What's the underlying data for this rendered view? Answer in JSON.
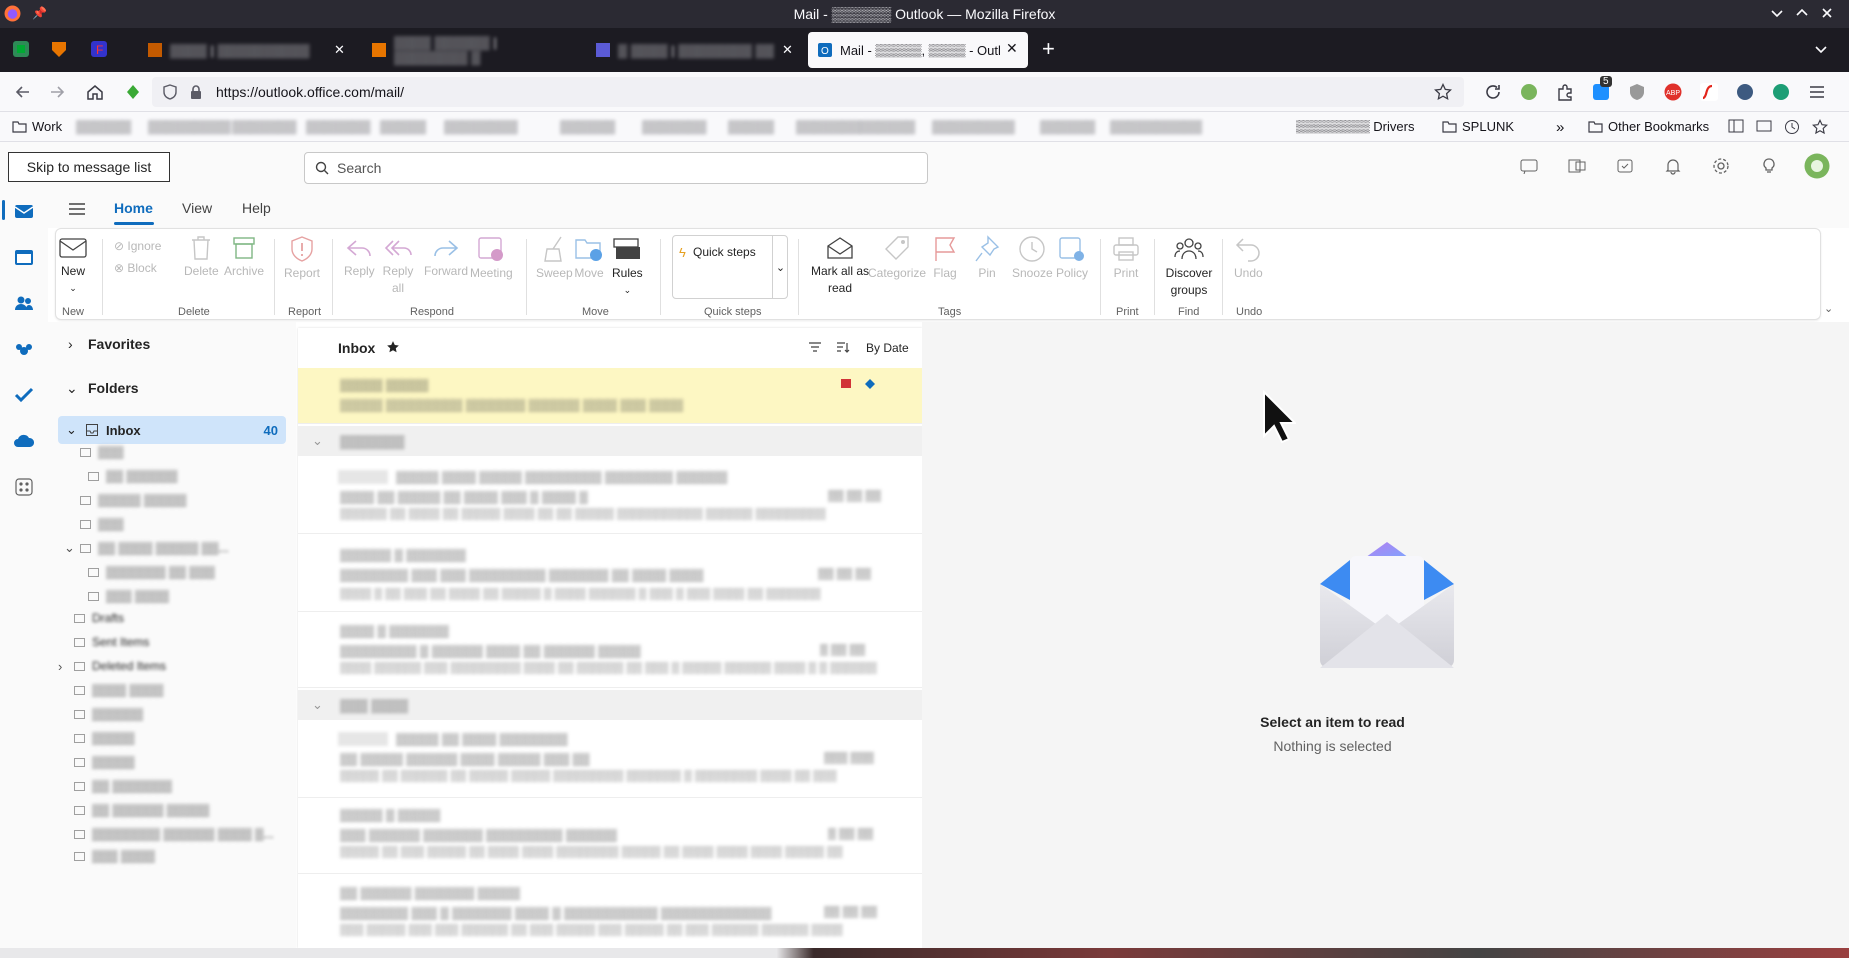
{
  "browser": {
    "window_title": "Mail - ▒▒▒▒▒▒ Outlook — Mozilla Firefox",
    "tabs": [
      {
        "label": "▒▒▒▒ | ▒▒▒▒▒▒▒▒▒▒"
      },
      {
        "label": "▒▒▒▒ ▒▒▒▒▒▒ | ▒▒▒▒▒▒▒▒ ▒"
      },
      {
        "label": "▒ ▒▒▒▒ | ▒▒▒▒▒▒▒▒ ▒▒"
      },
      {
        "label": "Mail - ▒▒▒▒▒, ▒▒▒▒ - Outlo"
      }
    ],
    "url": "https://outlook.office.com/mail/",
    "extension_badge": "5",
    "bookmarks": [
      "Work",
      "▒▒▒▒▒▒",
      "▒▒▒▒▒▒▒▒▒",
      "▒▒▒▒▒▒▒",
      "▒▒▒▒▒▒▒",
      "▒▒▒▒▒",
      "▒▒▒▒▒▒▒▒",
      "▒▒▒▒▒▒",
      "▒▒▒▒▒▒▒",
      "▒▒▒▒▒",
      "▒▒▒▒▒▒▒",
      "▒▒▒▒▒▒",
      "▒▒▒▒▒▒▒▒▒",
      "▒▒▒▒▒▒",
      "▒▒▒▒▒▒▒▒▒▒",
      "▒▒▒▒▒▒▒▒ Drivers",
      "SPLUNK"
    ],
    "other_bookmarks": "Other Bookmarks"
  },
  "outlook": {
    "skip_label": "Skip to message list",
    "search_placeholder": "Search",
    "ribbon_tabs": [
      "Home",
      "View",
      "Help"
    ],
    "ribbon": {
      "new": "New",
      "ignore": "Ignore",
      "block": "Block",
      "delete": "Delete",
      "archive": "Archive",
      "report": "Report",
      "reply": "Reply",
      "reply_all": "Reply all",
      "forward": "Forward",
      "meeting": "Meeting",
      "sweep": "Sweep",
      "move": "Move",
      "rules": "Rules",
      "quick_steps": "Quick steps",
      "mark_all_read": "Mark all as read",
      "categorize": "Categorize",
      "flag": "Flag",
      "pin": "Pin",
      "snooze": "Snooze",
      "policy": "Policy",
      "print": "Print",
      "discover_groups": "Discover groups",
      "undo": "Undo",
      "groups": {
        "new": "New",
        "delete": "Delete",
        "report": "Report",
        "respond": "Respond",
        "move": "Move",
        "quick_steps": "Quick steps",
        "tags": "Tags",
        "print": "Print",
        "find": "Find",
        "undo": "Undo"
      }
    },
    "favorites": "Favorites",
    "folders_label": "Folders",
    "inbox": {
      "label": "Inbox",
      "count": "40"
    },
    "folders": [
      {
        "label": "▒▒▒"
      },
      {
        "label": "▒▒ ▒▒▒▒▒▒"
      },
      {
        "label": "▒▒▒▒▒ ▒▒▒▒▒"
      },
      {
        "label": "▒▒▒"
      },
      {
        "label": "▒▒ ▒▒▒▒ ▒▒▒▒▒ ▒▒..."
      },
      {
        "label": "▒▒▒▒▒▒▒ ▒▒ ▒▒▒"
      },
      {
        "label": "▒▒▒ ▒▒▒▒"
      },
      {
        "label": "Drafts"
      },
      {
        "label": "Sent Items"
      },
      {
        "label": "Deleted Items"
      },
      {
        "label": "▒▒▒▒ ▒▒▒▒"
      },
      {
        "label": "▒▒▒▒▒▒"
      },
      {
        "label": "▒▒▒▒▒"
      },
      {
        "label": "▒▒▒▒▒"
      },
      {
        "label": "▒▒ ▒▒▒▒▒▒▒"
      },
      {
        "label": "▒▒ ▒▒▒▒▒▒ ▒▒▒▒▒"
      },
      {
        "label": "▒▒▒▒▒▒▒▒ ▒▒▒▒▒▒ ▒▒▒▒ ▒..."
      },
      {
        "label": "▒▒▒ ▒▒▒▒"
      }
    ],
    "list_title": "Inbox",
    "sort_label": "By Date",
    "groups": [
      "▒▒▒▒▒▒▒",
      "▒▒▒ ▒▒▒▒"
    ],
    "messages": [
      {
        "sender": "▒▒▒▒▒ ▒▒▒▒▒",
        "subject": "▒▒▒▒▒ ▒▒▒▒▒▒▒▒▒ ▒▒▒▒▒▒▒ ▒▒▒▒▒▒ ▒▒▒▒ ▒▒▒ ▒▒▒▒",
        "preview": "",
        "time": ""
      },
      {
        "sender": "▒▒▒▒▒ ▒▒▒▒ ▒▒▒▒▒ ▒▒▒▒▒▒▒▒▒ ▒▒▒▒▒▒▒▒ ▒▒▒▒▒▒",
        "subject": "▒▒▒▒ ▒▒ ▒▒▒▒▒ ▒▒ ▒▒▒▒ ▒▒▒ ▒ ▒▒▒▒ ▒",
        "preview": "▒▒▒▒▒▒ ▒▒ ▒▒▒▒ ▒▒ ▒▒▒▒▒ ▒▒▒▒ ▒▒ ▒▒ ▒▒▒▒▒ ▒▒▒▒▒▒▒▒▒▒▒ ▒▒▒▒▒▒ ▒▒▒▒▒▒▒▒▒",
        "time": "▒▒ ▒▒ ▒▒"
      },
      {
        "sender": "▒▒▒▒▒▒ ▒ ▒▒▒▒▒▒▒",
        "subject": "▒▒▒▒▒▒▒▒ ▒▒▒ ▒▒▒ ▒▒▒▒▒▒▒▒▒ ▒▒▒▒▒▒▒ ▒▒ ▒▒▒▒ ▒▒▒▒",
        "preview": "▒▒▒▒ ▒ ▒▒ ▒▒▒ ▒▒ ▒▒▒▒ ▒▒ ▒▒▒▒▒ ▒ ▒▒▒▒ ▒▒▒▒▒▒ ▒ ▒▒▒ ▒ ▒▒▒ ▒▒▒▒ ▒▒ ▒▒▒▒▒▒▒",
        "time": "▒▒ ▒▒ ▒▒"
      },
      {
        "sender": "▒▒▒▒ ▒ ▒▒▒▒▒▒▒",
        "subject": "▒▒▒▒▒▒▒▒▒ ▒ ▒▒▒▒▒▒ ▒▒▒▒ ▒▒ ▒▒▒▒▒▒ ▒▒▒▒▒",
        "preview": "▒▒▒▒ ▒▒▒▒▒▒ ▒▒▒ ▒▒▒▒▒▒▒▒▒ ▒▒▒▒ ▒▒ ▒▒▒▒▒▒ ▒▒ ▒▒▒ ▒ ▒▒▒▒▒ ▒▒▒▒▒▒ ▒▒▒▒ ▒ ▒ ▒▒▒▒▒▒",
        "time": "▒ ▒▒ ▒▒"
      },
      {
        "sender": "▒▒▒▒▒ ▒▒ ▒▒▒▒ ▒▒▒▒▒▒▒▒",
        "subject": "▒▒ ▒▒▒▒▒ ▒▒▒▒▒▒ ▒▒▒▒ ▒▒▒▒▒ ▒▒▒ ▒▒",
        "preview": "▒▒▒▒▒ ▒▒ ▒▒▒▒▒▒ ▒▒ ▒▒▒▒▒ ▒▒▒▒▒ ▒▒▒▒▒▒▒▒▒ ▒▒▒▒▒▒▒ ▒ ▒▒▒▒▒▒▒▒ ▒▒▒▒ ▒▒ ▒▒▒",
        "time": "▒▒▒ ▒▒▒"
      },
      {
        "sender": "▒▒▒▒▒ ▒ ▒▒▒▒▒",
        "subject": "▒▒▒ ▒▒▒▒▒▒ ▒▒▒▒▒▒▒ ▒▒▒▒▒▒▒▒▒ ▒▒▒▒▒▒",
        "preview": "▒▒▒▒▒ ▒▒ ▒▒▒ ▒▒▒▒▒ ▒▒ ▒▒▒▒ ▒▒▒▒ ▒▒▒▒▒▒▒▒ ▒▒▒▒▒ ▒▒ ▒▒▒▒ ▒▒▒▒ ▒▒▒▒ ▒▒▒▒▒ ▒▒",
        "time": "▒ ▒▒ ▒▒"
      },
      {
        "sender": "▒▒ ▒▒▒▒▒▒ ▒▒▒▒▒▒▒ ▒▒▒▒▒",
        "subject": "▒▒▒▒▒▒▒▒ ▒▒▒ ▒ ▒▒▒▒▒▒▒ ▒▒▒▒ ▒ ▒▒▒▒▒▒▒▒▒▒▒ ▒▒▒▒▒▒▒▒▒▒▒▒▒",
        "preview": "▒▒▒ ▒▒▒▒▒ ▒▒▒ ▒▒▒ ▒▒▒▒▒▒ ▒▒ ▒▒▒ ▒▒▒▒▒ ▒▒▒ ▒▒▒▒▒ ▒▒ ▒▒▒ ▒▒▒▒▒▒ ▒▒▒▒▒▒ ▒▒▒▒",
        "time": "▒▒ ▒▒ ▒▒"
      }
    ],
    "empty_title": "Select an item to read",
    "empty_sub": "Nothing is selected",
    "accent": "#0f6cbd"
  }
}
